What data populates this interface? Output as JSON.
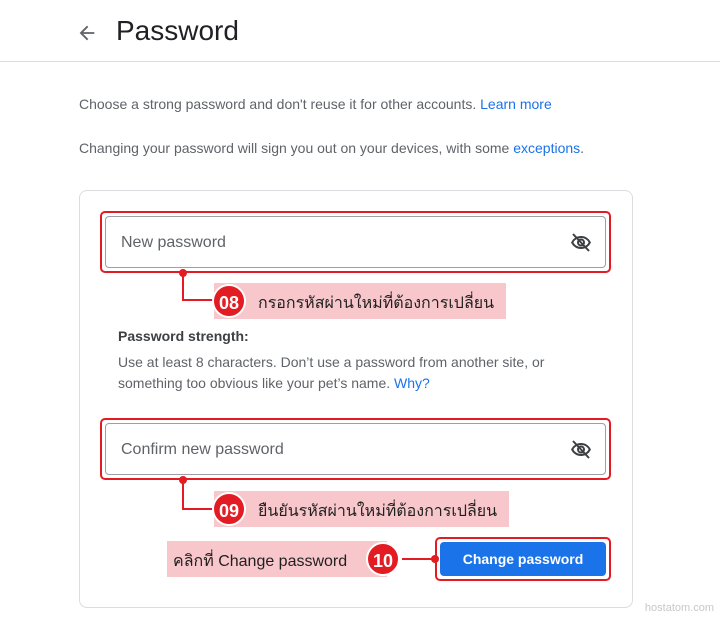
{
  "header": {
    "title": "Password"
  },
  "intro": {
    "line1": "Choose a strong password and don't reuse it for other accounts.",
    "line1_link": "Learn more",
    "line2": "Changing your password will sign you out on your devices, with some",
    "line2_link": "exceptions",
    "line2_end": "."
  },
  "form": {
    "new_password_placeholder": "New password",
    "confirm_password_placeholder": "Confirm new password",
    "strength_title": "Password strength:",
    "strength_text": "Use at least 8 characters. Don’t use a password from another site, or something too obvious like your pet’s name.",
    "strength_link": "Why?",
    "submit_label": "Change password"
  },
  "annotations": [
    {
      "number": "08",
      "text": "กรอกรหัสผ่านใหม่ที่ต้องการเปลี่ยน"
    },
    {
      "number": "09",
      "text": "ยืนยันรหัสผ่านใหม่ที่ต้องการเปลี่ยน"
    },
    {
      "number": "10",
      "text": "คลิกที่ Change password"
    }
  ],
  "watermark": "hostatom.com",
  "colors": {
    "accent": "#1a73e8",
    "annotation": "#e31c23",
    "annotation_bg": "#f8c7cc"
  }
}
